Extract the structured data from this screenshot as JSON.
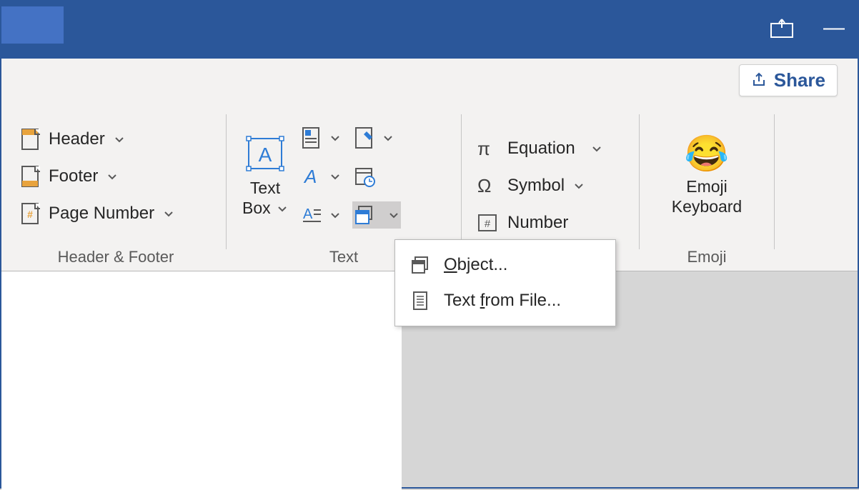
{
  "titlebar": {
    "share_label": "Share"
  },
  "ribbon": {
    "groups": {
      "header_footer": {
        "label": "Header & Footer",
        "header": "Header",
        "footer": "Footer",
        "page_number": "Page Number"
      },
      "text": {
        "label": "Text",
        "text_box_line1": "Text",
        "text_box_line2": "Box"
      },
      "symbols": {
        "equation": "Equation",
        "symbol": "Symbol",
        "number": "Number"
      },
      "emoji": {
        "label": "Emoji",
        "keyboard_line1": "Emoji",
        "keyboard_line2": "Keyboard"
      }
    }
  },
  "menu": {
    "object": "bject...",
    "object_prefix": "O",
    "text_from_file_p1": "Text ",
    "text_from_file_u": "f",
    "text_from_file_p2": "rom File..."
  }
}
